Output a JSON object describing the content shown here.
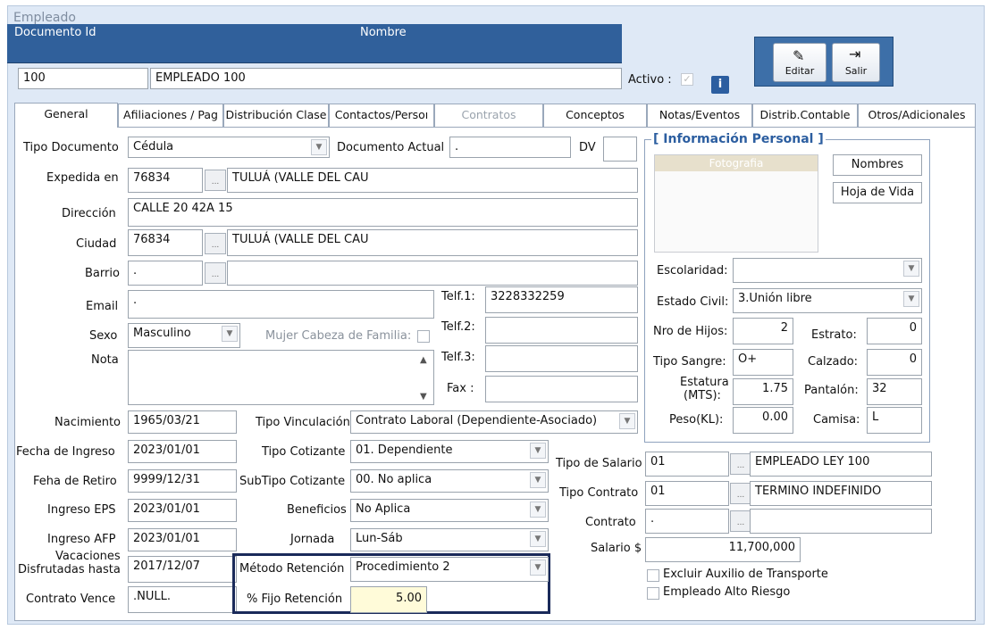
{
  "window": {
    "title": "Empleado"
  },
  "header": {
    "col_doc": "Documento Id",
    "col_name": "Nombre",
    "doc_id": "100",
    "name": "EMPLEADO 100",
    "activo_label": "Activo :",
    "info_icon": "i"
  },
  "toolbar": {
    "editar": "Editar",
    "salir": "Salir"
  },
  "tabs": [
    "General",
    "Afiliaciones / Pag",
    "Distribución Clase",
    "Contactos/Persoı",
    "Contratos",
    "Conceptos",
    "Notas/Eventos",
    "Distrib.Contable",
    "Otros/Adicionales"
  ],
  "general": {
    "tipo_doc_label": "Tipo Documento",
    "tipo_doc": "Cédula",
    "doc_actual_label": "Documento Actual",
    "doc_actual": ".",
    "dv_label": "DV",
    "dv": "",
    "expedida_label": "Expedida en",
    "expedida_code": "76834",
    "expedida_name": "TULUÁ (VALLE DEL CAU",
    "direccion_label": "Dirección",
    "direccion": "CALLE 20  42A 15",
    "ciudad_label": "Ciudad",
    "ciudad_code": "76834",
    "ciudad_name": "TULUÁ (VALLE DEL CAU",
    "barrio_label": "Barrio",
    "barrio_code": ".",
    "barrio_name": "",
    "email_label": "Email",
    "email": ".",
    "telf1_label": "Telf.1:",
    "telf1": "3228332259",
    "telf2_label": "Telf.2:",
    "telf2": "",
    "telf3_label": "Telf.3:",
    "telf3": "",
    "fax_label": "Fax :",
    "fax": "",
    "sexo_label": "Sexo",
    "sexo": "Masculino",
    "mujer_label": "Mujer Cabeza de Familia:",
    "nota_label": "Nota",
    "nota": "",
    "nacimiento_label": "Nacimiento",
    "nacimiento": "1965/03/21",
    "fecha_ingreso_label": "Fecha de Ingreso",
    "fecha_ingreso": "2023/01/01",
    "fecha_retiro_label": "Feha de Retiro",
    "fecha_retiro": "9999/12/31",
    "ingreso_eps_label": "Ingreso EPS",
    "ingreso_eps": "2023/01/01",
    "ingreso_afp_label": "Ingreso AFP",
    "ingreso_afp": "2023/01/01",
    "vacaciones_label1": "Vacaciones",
    "vacaciones_label2": "Disfrutadas hasta",
    "vacaciones": "2017/12/07",
    "contrato_vence_label": "Contrato Vence",
    "contrato_vence": ".NULL.",
    "tipo_vinc_label": "Tipo Vinculación",
    "tipo_vinc": "Contrato Laboral (Dependiente-Asociado)",
    "tipo_cot_label": "Tipo Cotizante",
    "tipo_cot": "01. Dependiente",
    "subtipo_label": "SubTipo Cotizante",
    "subtipo": "00. No aplica",
    "beneficios_label": "Beneficios",
    "beneficios": "No Aplica",
    "jornada_label": "Jornada",
    "jornada": "Lun-Sáb",
    "metodo_label": "Método Retención",
    "metodo": "Procedimiento 2",
    "fijo_label": "% Fijo Retención",
    "fijo": "5.00",
    "tipo_salario_label": "Tipo de Salario",
    "tipo_salario_code": "01",
    "tipo_salario_name": "EMPLEADO LEY 100",
    "tipo_contrato_label": "Tipo Contrato",
    "tipo_contrato_code": "01",
    "tipo_contrato_name": "TERMINO INDEFINIDO",
    "contrato_label": "Contrato",
    "contrato_code": ".",
    "contrato_name": "",
    "salario_label": "Salario $",
    "salario": "11,700,000",
    "excluir_label": "Excluir Auxilio de Transporte",
    "alto_riesgo_label": "Empleado Alto Riesgo"
  },
  "personal": {
    "title": "[ Información Personal ]",
    "foto_label": "Fotografia",
    "nombres_btn": "Nombres",
    "hoja_btn": "Hoja de Vida",
    "escolaridad_label": "Escolaridad:",
    "escolaridad": "",
    "estado_civil_label": "Estado Civil:",
    "estado_civil": "3.Unión libre",
    "hijos_label": "Nro de Hijos:",
    "hijos": "2",
    "estrato_label": "Estrato:",
    "estrato": "0",
    "sangre_label": "Tipo Sangre:",
    "sangre": "O+",
    "calzado_label": "Calzado:",
    "calzado": "0",
    "estatura_label1": "Estatura",
    "estatura_label2": "(MTS):",
    "estatura": "1.75",
    "pantalon_label": "Pantalón:",
    "pantalon": "32",
    "peso_label": "Peso(KL):",
    "peso": "0.00",
    "camisa_label": "Camisa:",
    "camisa": "L"
  }
}
